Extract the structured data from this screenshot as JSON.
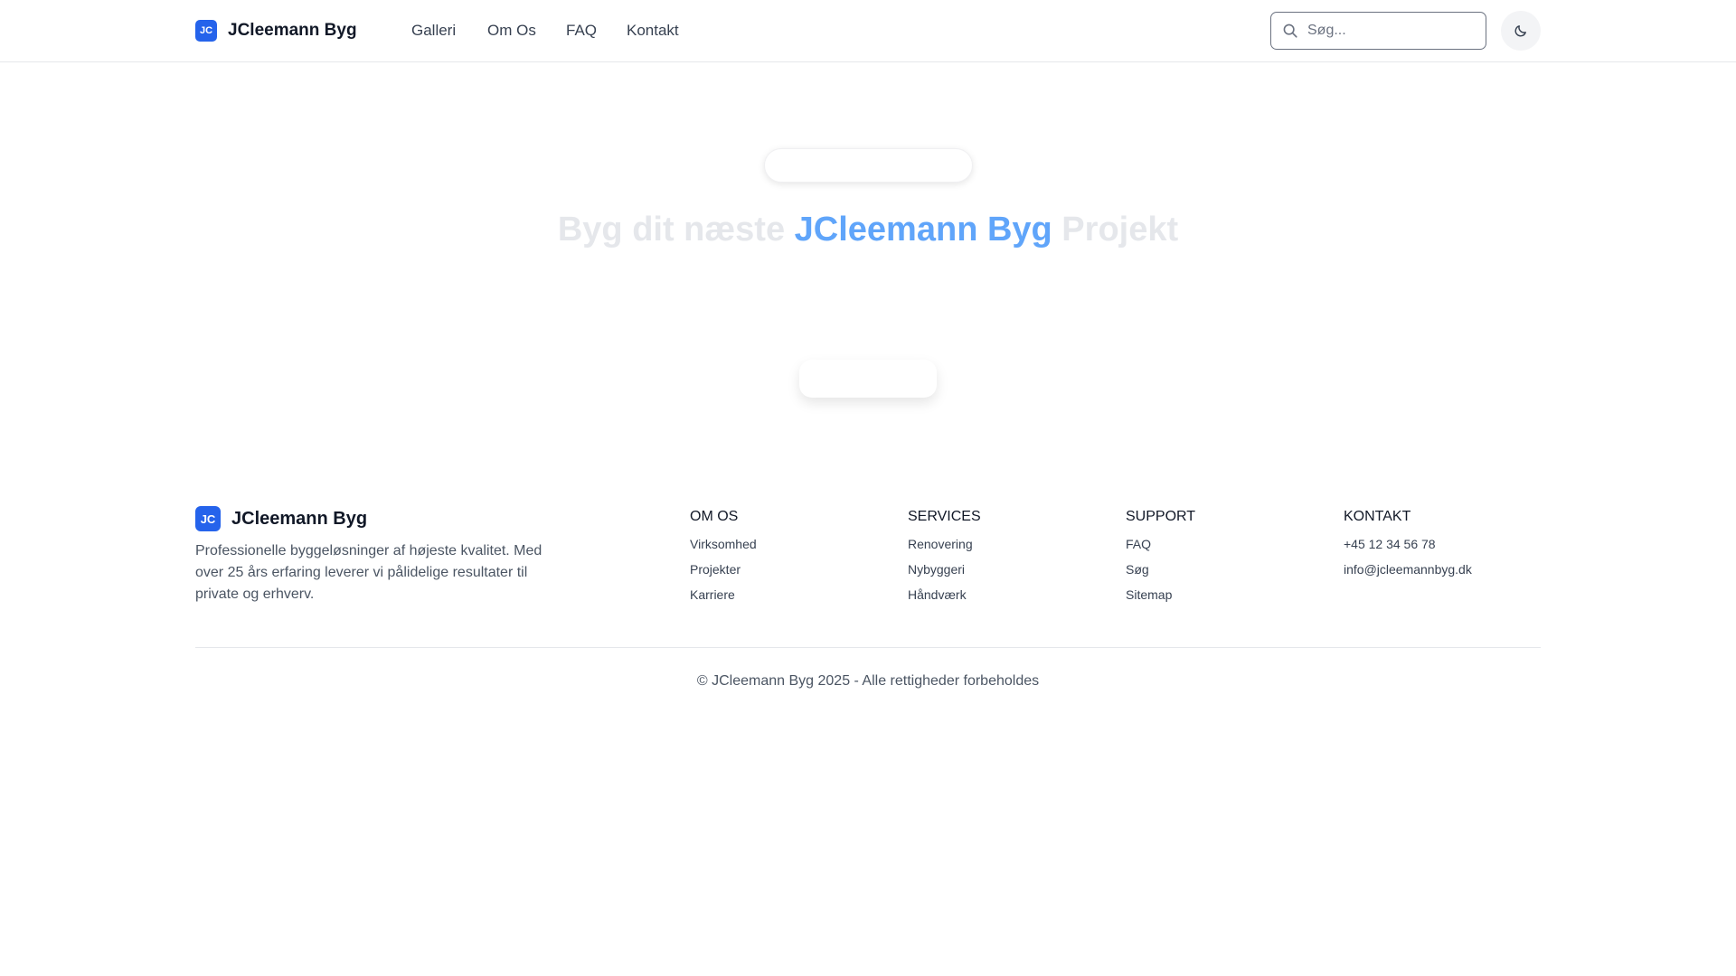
{
  "header": {
    "brand_badge": "JC",
    "brand_name": "JCleemann Byg",
    "nav": [
      {
        "label": "Galleri"
      },
      {
        "label": "Om Os"
      },
      {
        "label": "FAQ"
      },
      {
        "label": "Kontakt"
      }
    ],
    "search": {
      "placeholder": "Søg...",
      "value": ""
    },
    "theme_toggle_icon": "moon-icon"
  },
  "hero": {
    "title_before": "Byg dit næste ",
    "title_accent": "JCleemann Byg",
    "title_after": " Projekt"
  },
  "footer": {
    "brand_badge": "JC",
    "brand_name": "JCleemann Byg",
    "description": "Professionelle byggeløsninger af højeste kvalitet. Med over 25 års erfaring leverer vi pålidelige resultater til private og erhverv.",
    "columns": [
      {
        "title": "OM OS",
        "links": [
          "Virksomhed",
          "Projekter",
          "Karriere"
        ]
      },
      {
        "title": "SERVICES",
        "links": [
          "Renovering",
          "Nybyggeri",
          "Håndværk"
        ]
      },
      {
        "title": "SUPPORT",
        "links": [
          "FAQ",
          "Søg",
          "Sitemap"
        ]
      },
      {
        "title": "KONTAKT",
        "links": [
          "+45 12 34 56 78",
          "info@jcleemannbyg.dk"
        ]
      }
    ],
    "copyright": "© JCleemann Byg 2025 - Alle rettigheder forbeholdes"
  },
  "colors": {
    "brand": "#2563eb",
    "accent_text": "#60a5fa",
    "muted_title": "#e5e7eb"
  }
}
